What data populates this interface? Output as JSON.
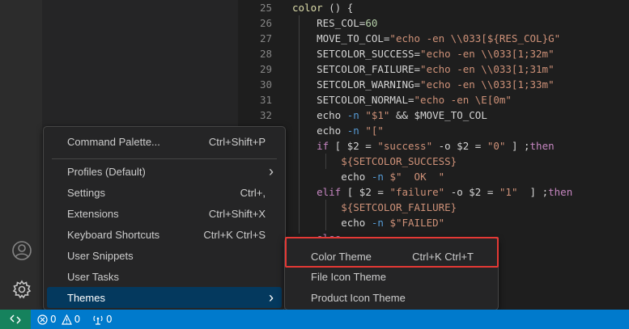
{
  "editor": {
    "lines": [
      {
        "n": "25",
        "seg": [
          [
            "fn",
            "color"
          ],
          [
            "pl",
            " () {"
          ]
        ]
      },
      {
        "n": "26",
        "seg": [
          [
            "pl",
            "    RES_COL="
          ],
          [
            "num",
            "60"
          ]
        ]
      },
      {
        "n": "27",
        "seg": [
          [
            "pl",
            "    MOVE_TO_COL="
          ],
          [
            "str",
            "\"echo -en \\\\033[${RES_COL}G\""
          ]
        ]
      },
      {
        "n": "28",
        "seg": [
          [
            "pl",
            "    SETCOLOR_SUCCESS="
          ],
          [
            "str",
            "\"echo -en \\\\033[1;32m\""
          ]
        ]
      },
      {
        "n": "29",
        "seg": [
          [
            "pl",
            "    SETCOLOR_FAILURE="
          ],
          [
            "str",
            "\"echo -en \\\\033[1;31m\""
          ]
        ]
      },
      {
        "n": "30",
        "seg": [
          [
            "pl",
            "    SETCOLOR_WARNING="
          ],
          [
            "str",
            "\"echo -en \\\\033[1;33m\""
          ]
        ]
      },
      {
        "n": "31",
        "seg": [
          [
            "pl",
            "    SETCOLOR_NORMAL="
          ],
          [
            "str",
            "\"echo -en \\E[0m\""
          ]
        ]
      },
      {
        "n": "32",
        "seg": [
          [
            "pl",
            "    echo "
          ],
          [
            "kw",
            "-n"
          ],
          [
            "pl",
            " "
          ],
          [
            "str",
            "\"$1\""
          ],
          [
            "pl",
            " && $MOVE_TO_COL"
          ]
        ]
      },
      {
        "n": "",
        "seg": [
          [
            "pl",
            "    echo "
          ],
          [
            "kw",
            "-n"
          ],
          [
            "pl",
            " "
          ],
          [
            "str",
            "\"[\""
          ]
        ]
      },
      {
        "n": "",
        "seg": [
          [
            "ctl",
            "    if"
          ],
          [
            "pl",
            " [ $2 = "
          ],
          [
            "str",
            "\"success\""
          ],
          [
            "pl",
            " -o $2 = "
          ],
          [
            "str",
            "\"0\""
          ],
          [
            "pl",
            " ] ;"
          ],
          [
            "ctl",
            "then"
          ]
        ]
      },
      {
        "n": "",
        "seg": [
          [
            "pl",
            "        "
          ],
          [
            "str",
            "${SETCOLOR_SUCCESS}"
          ]
        ]
      },
      {
        "n": "",
        "seg": [
          [
            "pl",
            "        echo "
          ],
          [
            "kw",
            "-n"
          ],
          [
            "pl",
            " "
          ],
          [
            "str",
            "$\"  OK  \""
          ]
        ]
      },
      {
        "n": "",
        "seg": [
          [
            "ctl",
            "    elif"
          ],
          [
            "pl",
            " [ $2 = "
          ],
          [
            "str",
            "\"failure\""
          ],
          [
            "pl",
            " -o $2 = "
          ],
          [
            "str",
            "\"1\""
          ],
          [
            "pl",
            "  ] ;"
          ],
          [
            "ctl",
            "then"
          ]
        ]
      },
      {
        "n": "",
        "seg": [
          [
            "pl",
            "        "
          ],
          [
            "str",
            "${SETCOLOR_FAILURE}"
          ]
        ]
      },
      {
        "n": "",
        "seg": [
          [
            "pl",
            "        echo "
          ],
          [
            "kw",
            "-n"
          ],
          [
            "pl",
            " "
          ],
          [
            "str",
            "$\"FAILED\""
          ]
        ]
      },
      {
        "n": "",
        "seg": [
          [
            "ctl",
            "    else"
          ]
        ]
      }
    ]
  },
  "manage_menu": {
    "items": [
      {
        "label": "Command Palette...",
        "keybinding": "Ctrl+Shift+P"
      },
      {
        "label": "Profiles (Default)",
        "submenu_glyph": "›"
      },
      {
        "label": "Settings",
        "keybinding": "Ctrl+,"
      },
      {
        "label": "Extensions",
        "keybinding": "Ctrl+Shift+X"
      },
      {
        "label": "Keyboard Shortcuts",
        "keybinding": "Ctrl+K Ctrl+S"
      },
      {
        "label": "User Snippets",
        "keybinding": ""
      },
      {
        "label": "User Tasks",
        "keybinding": ""
      },
      {
        "label": "Themes",
        "submenu_glyph": "›"
      }
    ]
  },
  "themes_submenu": {
    "items": [
      {
        "label": "Color Theme",
        "keybinding": "Ctrl+K Ctrl+T"
      },
      {
        "label": "File Icon Theme",
        "keybinding": ""
      },
      {
        "label": "Product Icon Theme",
        "keybinding": ""
      }
    ]
  },
  "status_bar": {
    "errors": "0",
    "warnings": "0",
    "ports": "0"
  },
  "colors": {
    "highlight_border": "#e53935",
    "status_bar": "#007acc",
    "remote_indicator": "#16825d",
    "selected_item": "#04395e"
  },
  "icons": {
    "remote": "remote-icon",
    "account": "account-icon",
    "manage": "gear-icon",
    "errors": "error-icon",
    "warnings": "warning-icon",
    "ports": "ports-icon"
  }
}
